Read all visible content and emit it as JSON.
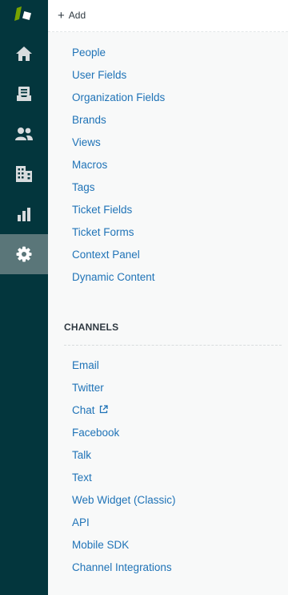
{
  "topbar": {
    "add_label": "Add"
  },
  "rail": {
    "items": [
      {
        "name": "home",
        "icon": "home-icon"
      },
      {
        "name": "views",
        "icon": "tray-icon"
      },
      {
        "name": "customers",
        "icon": "people-icon"
      },
      {
        "name": "organizations",
        "icon": "building-icon"
      },
      {
        "name": "reporting",
        "icon": "bar-chart-icon"
      },
      {
        "name": "admin",
        "icon": "gear-icon",
        "active": true
      }
    ],
    "colors": {
      "background": "#03363d",
      "active": "#5a7679",
      "icon": "#d8dcde"
    }
  },
  "manage": {
    "links": [
      "People",
      "User Fields",
      "Organization Fields",
      "Brands",
      "Views",
      "Macros",
      "Tags",
      "Ticket Fields",
      "Ticket Forms",
      "Context Panel",
      "Dynamic Content"
    ]
  },
  "channels": {
    "title": "CHANNELS",
    "links": [
      "Email",
      "Twitter",
      "Chat",
      "Facebook",
      "Talk",
      "Text",
      "Web Widget (Classic)",
      "API",
      "Mobile SDK",
      "Channel Integrations"
    ]
  },
  "colors": {
    "link": "#1f73b7",
    "heading": "#2f3941",
    "panel": "#f8f9f9"
  }
}
